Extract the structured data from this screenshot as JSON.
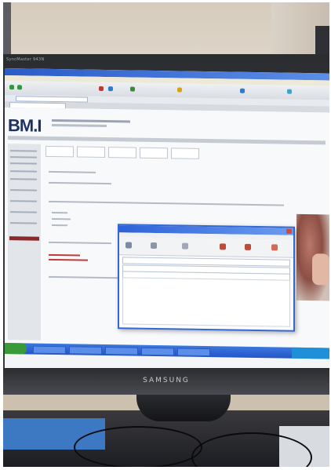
{
  "monitor": {
    "brand": "SAMSUNG",
    "bezel_label": "SyncMaster 943N"
  },
  "screen": {
    "logo": "BM.I",
    "colors": {
      "titlebar": "#2a5bc8",
      "taskbar": "#2455c7",
      "logo": "#1f3160",
      "accent_red": "#c23a3a"
    }
  }
}
